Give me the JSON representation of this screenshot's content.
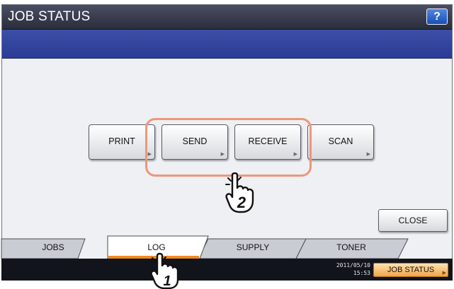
{
  "title": "JOB STATUS",
  "help_label": "?",
  "categories": [
    {
      "label": "PRINT"
    },
    {
      "label": "SEND"
    },
    {
      "label": "RECEIVE"
    },
    {
      "label": "SCAN"
    }
  ],
  "close_label": "CLOSE",
  "tabs": [
    {
      "label": "JOBS",
      "selected": false
    },
    {
      "label": "LOG",
      "selected": true
    },
    {
      "label": "SUPPLY",
      "selected": false
    },
    {
      "label": "TONER",
      "selected": false
    }
  ],
  "status_bar": {
    "date": "2011/05/10",
    "time": "15:53",
    "job_status_label": "JOB STATUS"
  },
  "callouts": {
    "step1": "1",
    "step2": "2"
  },
  "colors": {
    "title_bar": "#2f3344",
    "blue_bar": "#2f42a0",
    "highlight": "#ef957c",
    "tab_selected_accent": "#ef8a22",
    "job_status_button": "#f2a44a"
  }
}
